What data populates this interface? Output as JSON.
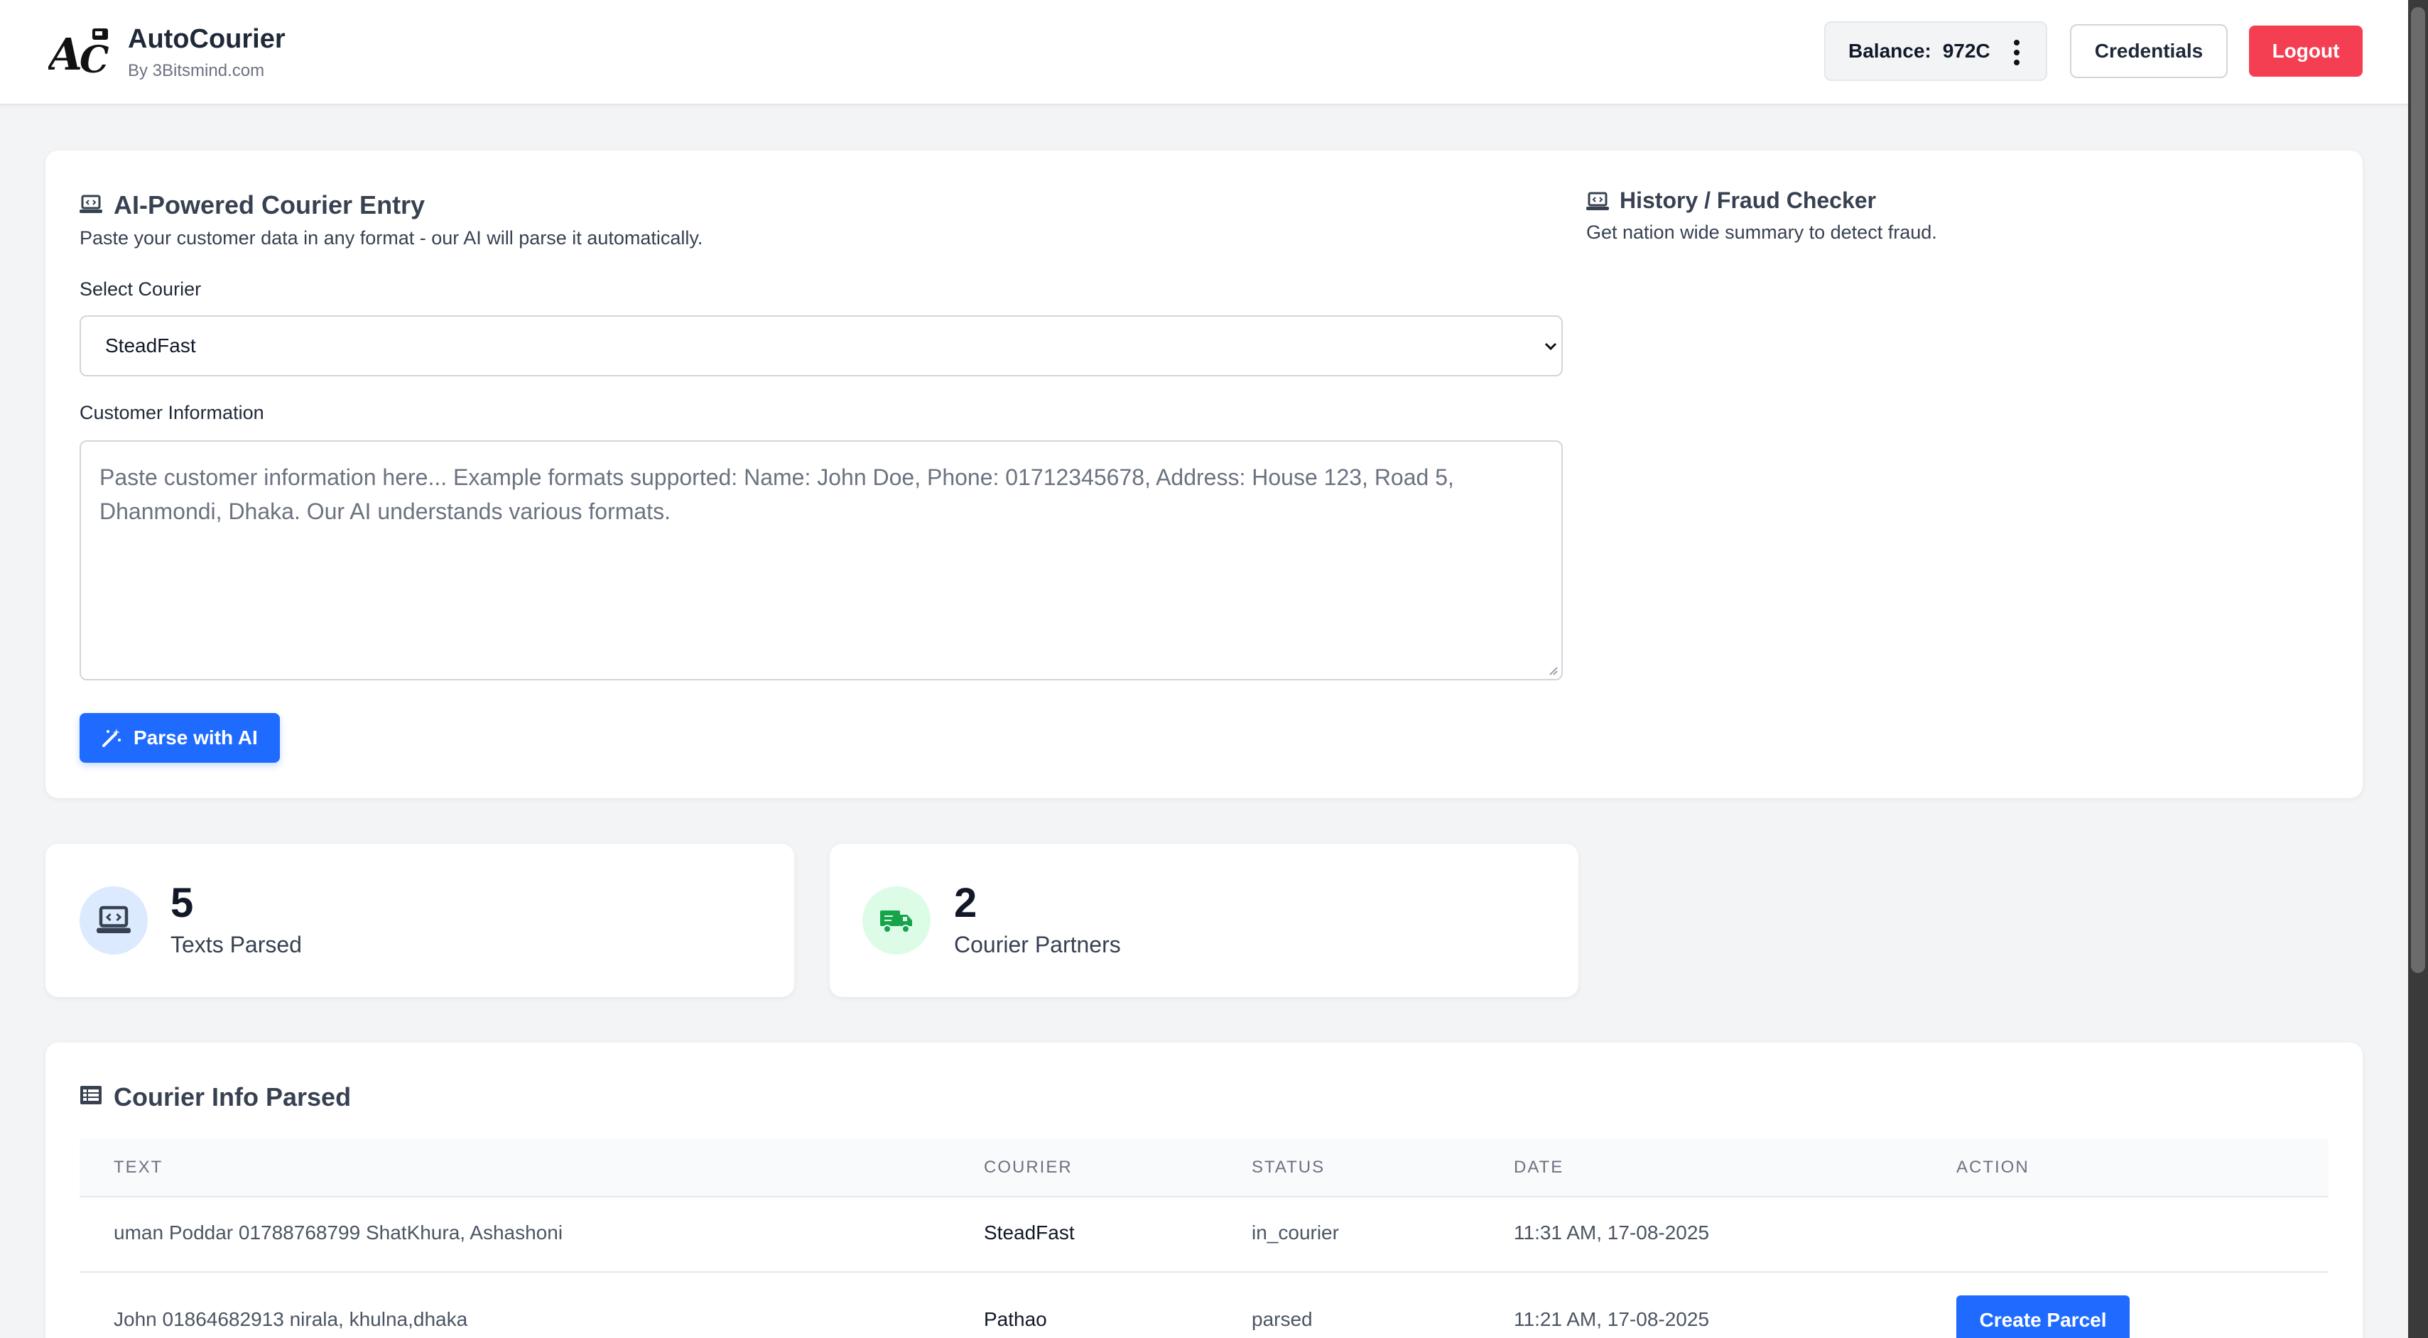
{
  "header": {
    "app_name": "AutoCourier",
    "app_sub": "By 3Bitsmind.com",
    "balance_label": "Balance:",
    "balance_value": "972C",
    "credentials_label": "Credentials",
    "logout_label": "Logout"
  },
  "entry": {
    "title": "AI-Powered Courier Entry",
    "description": "Paste your customer data in any format - our AI will parse it automatically.",
    "select_label": "Select Courier",
    "selected_courier": "SteadFast",
    "info_label": "Customer Information",
    "placeholder": "Paste customer information here... Example formats supported: Name: John Doe, Phone: 01712345678, Address: House 123, Road 5, Dhanmondi, Dhaka. Our AI understands various formats.",
    "parse_button": "Parse with AI"
  },
  "fraud": {
    "title": "History / Fraud Checker",
    "description": "Get nation wide summary to detect fraud."
  },
  "stats": [
    {
      "value": "5",
      "label": "Texts Parsed",
      "icon": "laptop-code-icon",
      "color": "#dbeafe"
    },
    {
      "value": "2",
      "label": "Courier Partners",
      "icon": "truck-icon",
      "color": "#dcfce7"
    }
  ],
  "table": {
    "title": "Courier Info Parsed",
    "columns": [
      "TEXT",
      "COURIER",
      "STATUS",
      "DATE",
      "ACTION"
    ],
    "rows": [
      {
        "text": "uman Poddar 01788768799 ShatKhura, Ashashoni",
        "courier": "SteadFast",
        "status": "in_courier",
        "date": "11:31 AM, 17-08-2025",
        "action": ""
      },
      {
        "text": "John 01864682913 nirala, khulna,dhaka",
        "courier": "Pathao",
        "status": "parsed",
        "date": "11:21 AM, 17-08-2025",
        "action": "Create Parcel"
      }
    ]
  },
  "colors": {
    "primary": "#1f6bff",
    "danger": "#f43f52",
    "background": "#f3f4f6"
  }
}
